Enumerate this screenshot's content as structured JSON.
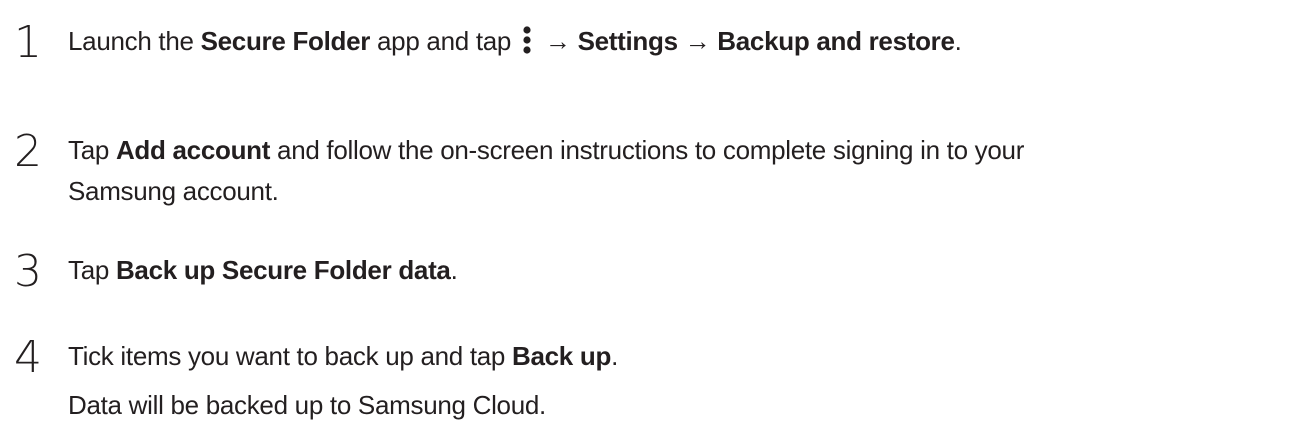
{
  "steps": [
    {
      "number": "1",
      "t1": "Launch the ",
      "b1": "Secure Folder",
      "t2": " app and tap ",
      "icon": "more-options-icon",
      "arrow1": " → ",
      "b2": "Settings",
      "arrow2": " → ",
      "b3": "Backup and restore",
      "t3": "."
    },
    {
      "number": "2",
      "t1": "Tap ",
      "b1": "Add account",
      "t2": " and follow the on-screen instructions to complete signing in to your",
      "line2": "Samsung account."
    },
    {
      "number": "3",
      "t1": "Tap ",
      "b1": "Back up Secure Folder data",
      "t2": "."
    },
    {
      "number": "4",
      "t1": "Tick items you want to back up and tap ",
      "b1": "Back up",
      "t2": ".",
      "note": "Data will be backed up to Samsung Cloud."
    }
  ]
}
